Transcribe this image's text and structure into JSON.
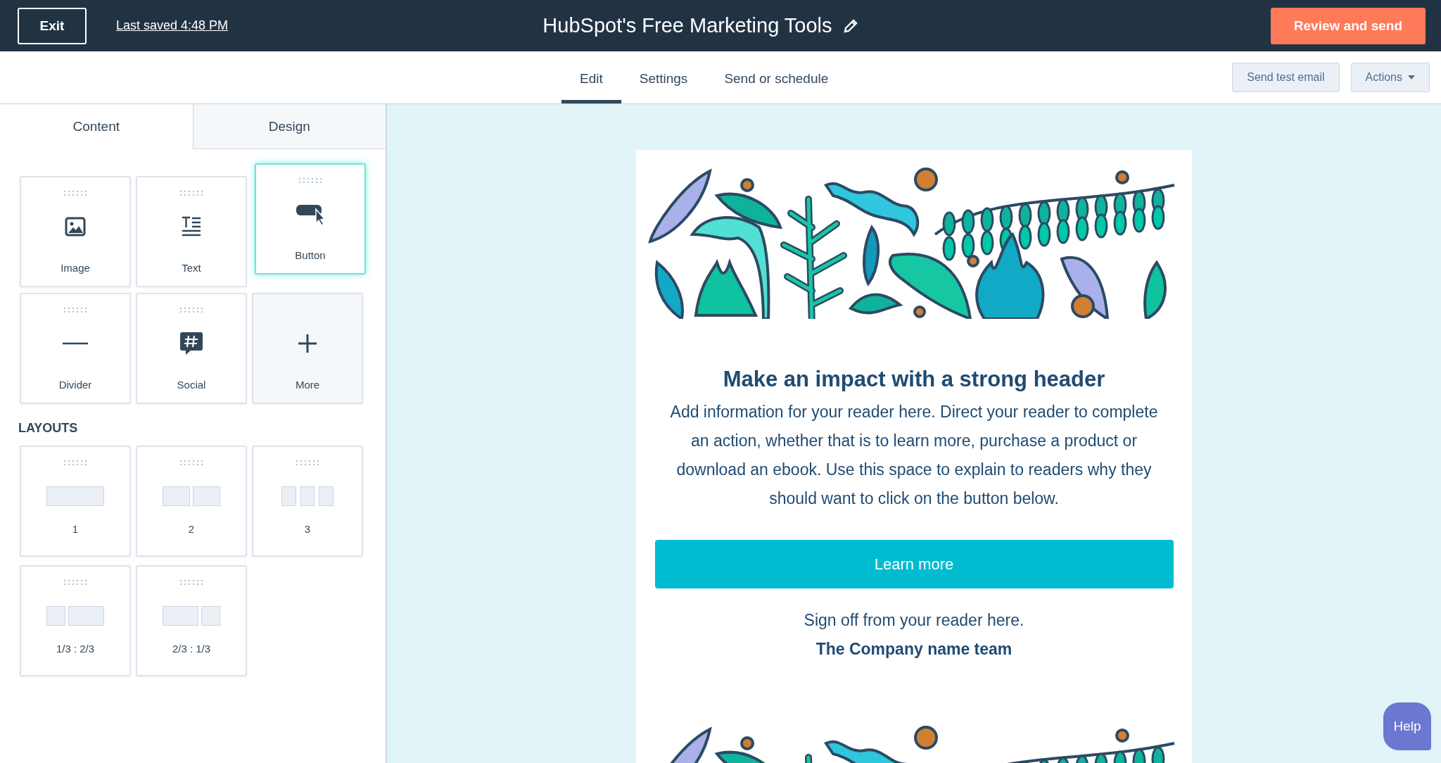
{
  "top_bar": {
    "exit_button": "Exit",
    "last_saved": "Last saved 4:48 PM",
    "title": "HubSpot's Free Marketing Tools",
    "primary_button": "Review and send"
  },
  "nav_tabs": [
    {
      "label": "Edit",
      "selected": true
    },
    {
      "label": "Settings",
      "selected": false
    },
    {
      "label": "Send or schedule",
      "selected": false
    }
  ],
  "toolbar_buttons": [
    {
      "label": "Send test email",
      "kind": "button"
    },
    {
      "label": "Actions",
      "kind": "dropdown"
    }
  ],
  "sidebar": {
    "tabs": [
      {
        "label": "Content",
        "selected": true
      },
      {
        "label": "Design",
        "selected": false
      }
    ],
    "modules": [
      {
        "label": "Image",
        "kind": "image",
        "selected": false
      },
      {
        "label": "Text",
        "kind": "text",
        "selected": false
      },
      {
        "label": "Button",
        "kind": "button",
        "selected": true
      },
      {
        "label": "Divider",
        "kind": "divider",
        "selected": false
      },
      {
        "label": "Social",
        "kind": "social",
        "selected": false
      },
      {
        "label": "More",
        "kind": "more",
        "selected": false
      }
    ],
    "layouts_heading": "LAYOUTS",
    "layouts": [
      {
        "label": "1",
        "kind": "one"
      },
      {
        "label": "2",
        "kind": "two"
      },
      {
        "label": "3",
        "kind": "three"
      },
      {
        "label": "1/3 : 2/3",
        "kind": "third-twothirds"
      },
      {
        "label": "2/3 : 1/3",
        "kind": "twothirds-third"
      }
    ]
  },
  "email": {
    "heading": "Make an impact with a strong header",
    "body": "Add information for your reader here. Direct your reader to complete an action, whether that is to learn more, purchase a product or download an ebook. Use this space to explain to readers why they should want to click on the button below.",
    "button": "Learn more",
    "sign_off": "Sign off from your reader here.",
    "team": "The Company name team"
  },
  "help_button": "Help"
}
